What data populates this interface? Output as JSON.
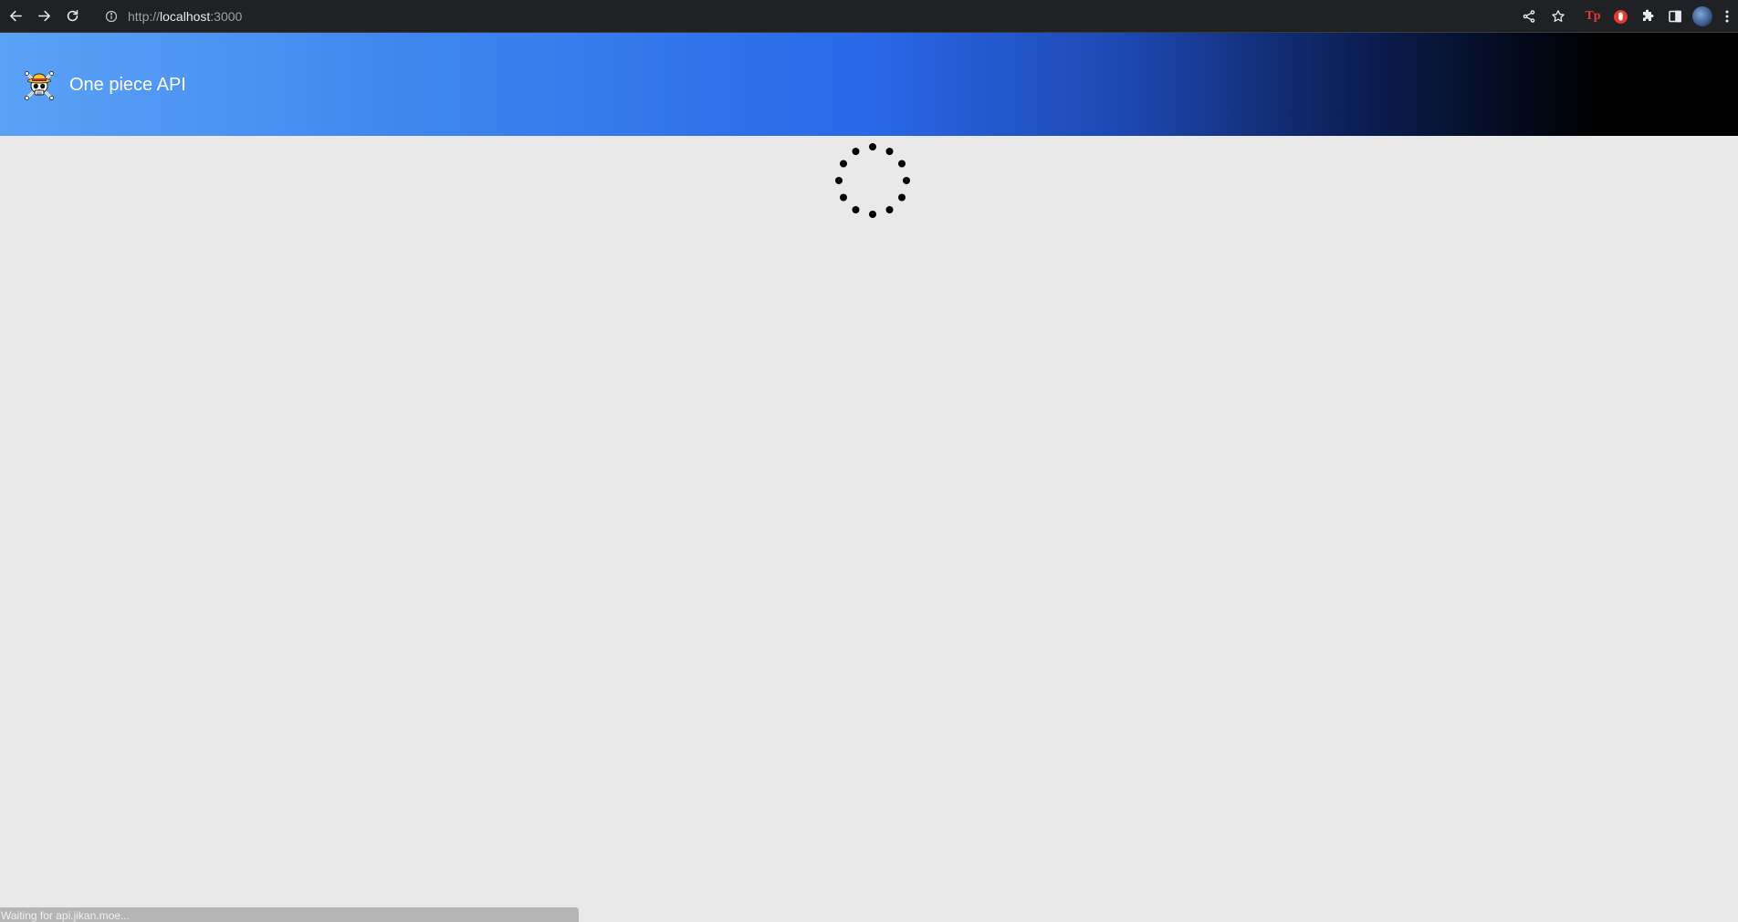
{
  "browser": {
    "url_scheme": "http://",
    "url_host": "localhost",
    "url_port": ":3000",
    "extension_tp_label": "Tp"
  },
  "app": {
    "title": "One piece API",
    "gradient_colors": [
      "#5ba2f6",
      "#2968e8",
      "#000000"
    ]
  },
  "status_bar": {
    "text": "Waiting for api.jikan.moe..."
  }
}
